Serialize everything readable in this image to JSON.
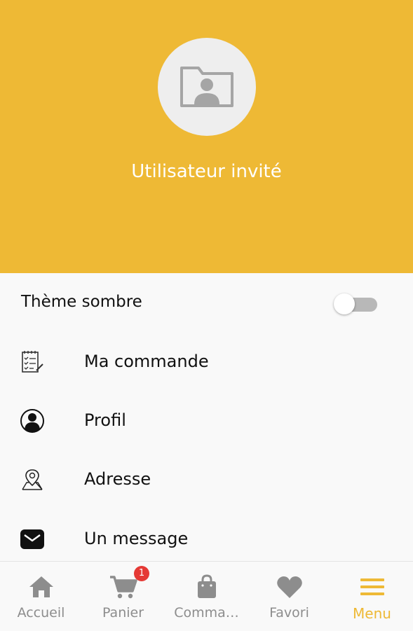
{
  "header": {
    "username": "Utilisateur invité",
    "background_color": "#eeb935",
    "avatar_icon": "user-folder-icon"
  },
  "settings": {
    "dark_theme_label": "Thème sombre",
    "dark_theme_enabled": false
  },
  "menu": {
    "items": [
      {
        "label": "Ma commande",
        "icon": "order-list-icon"
      },
      {
        "label": "Profil",
        "icon": "user-circle-icon"
      },
      {
        "label": "Adresse",
        "icon": "map-pin-icon"
      },
      {
        "label": "Un message",
        "icon": "envelope-icon"
      }
    ]
  },
  "bottom_nav": {
    "items": [
      {
        "label": "Accueil",
        "icon": "home-icon"
      },
      {
        "label": "Panier",
        "icon": "cart-icon",
        "badge": "1"
      },
      {
        "label": "Comma…",
        "icon": "shopping-bag-icon"
      },
      {
        "label": "Favori",
        "icon": "heart-icon"
      },
      {
        "label": "Menu",
        "icon": "hamburger-menu-icon",
        "active": true
      }
    ],
    "active_color": "#eeb935",
    "inactive_color": "#8d8d8d",
    "badge_color": "#e53935"
  }
}
